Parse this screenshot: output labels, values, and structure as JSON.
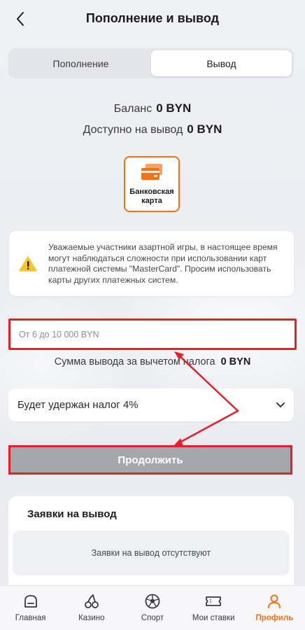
{
  "header": {
    "title": "Пополнение и вывод"
  },
  "tabs": [
    {
      "label": "Пополнение",
      "active": false
    },
    {
      "label": "Вывод",
      "active": true
    }
  ],
  "balance": {
    "label": "Баланс",
    "value": "0 BYN"
  },
  "available": {
    "label": "Доступно на вывод",
    "value": "0 BYN"
  },
  "method": {
    "label": "Банковская карта",
    "icon": "bank-card-icon",
    "accent": "#f07417"
  },
  "warning": {
    "icon": "warning-icon",
    "text": "Уважаемые участники азартной игры, в настоящее время могут наблюдаться сложности при использовании карт платежной системы \"MasterCard\". Просим использовать карты других платежных систем."
  },
  "amount": {
    "placeholder": "От 6 до 10 000 BYN",
    "value": ""
  },
  "net": {
    "label": "Сумма вывода за вычетом налога",
    "value": "0 BYN"
  },
  "tax": {
    "label": "Будет удержан налог 4%"
  },
  "continue": {
    "label": "Продолжить"
  },
  "requests": {
    "title": "Заявки на вывод",
    "empty": "Заявки на вывод отсутствуют"
  },
  "nav": [
    {
      "label": "Главная",
      "icon": "home-icon",
      "active": false
    },
    {
      "label": "Казино",
      "icon": "cherries-icon",
      "active": false
    },
    {
      "label": "Спорт",
      "icon": "soccer-ball-icon",
      "active": false
    },
    {
      "label": "Мои ставки",
      "icon": "ticket-icon",
      "active": false
    },
    {
      "label": "Профиль",
      "icon": "profile-icon",
      "active": true
    }
  ],
  "colors": {
    "accent": "#f07417",
    "highlight": "#e5202b",
    "disabled_button": "#a6a7ad"
  }
}
